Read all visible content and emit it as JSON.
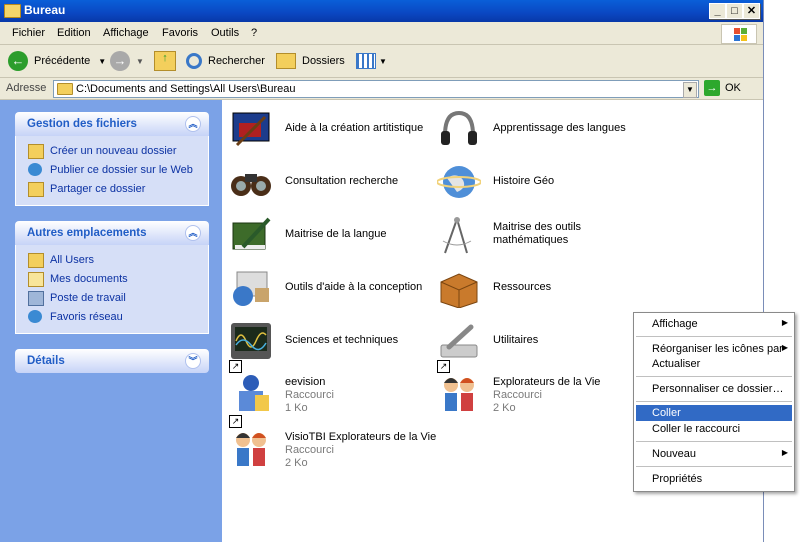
{
  "window": {
    "title": "Bureau",
    "minimize_glyph": "_",
    "maximize_glyph": "□",
    "close_glyph": "✕"
  },
  "menu": [
    "Fichier",
    "Edition",
    "Affichage",
    "Favoris",
    "Outils",
    "?"
  ],
  "toolbar": {
    "back": "Précédente",
    "search": "Rechercher",
    "folders": "Dossiers"
  },
  "address": {
    "label": "Adresse",
    "value": "C:\\Documents and Settings\\All Users\\Bureau",
    "go": "OK"
  },
  "sidebar": {
    "file_tasks": {
      "title": "Gestion des fichiers",
      "items": [
        "Créer un nouveau dossier",
        "Publier ce dossier sur le Web",
        "Partager ce dossier"
      ]
    },
    "other_places": {
      "title": "Autres emplacements",
      "items": [
        "All Users",
        "Mes documents",
        "Poste de travail",
        "Favoris réseau"
      ]
    },
    "details": {
      "title": "Détails"
    }
  },
  "items": [
    {
      "name": "Aide à la création artitistique",
      "icon": "art-palette-icon"
    },
    {
      "name": "Apprentissage des langues",
      "icon": "headphones-icon"
    },
    {
      "name": "Consultation recherche",
      "icon": "binoculars-icon"
    },
    {
      "name": "Histoire Géo",
      "icon": "globe-icon"
    },
    {
      "name": "Maitrise de la langue",
      "icon": "book-pen-icon"
    },
    {
      "name": "Maitrise des outils mathématiques",
      "icon": "compass-icon"
    },
    {
      "name": "Outils d'aide à la conception",
      "icon": "tools-globe-icon"
    },
    {
      "name": "Ressources",
      "icon": "box-icon"
    },
    {
      "name": "Sciences et techniques",
      "icon": "oscilloscope-icon"
    },
    {
      "name": "Utilitaires",
      "icon": "wrench-icon"
    },
    {
      "name": "eevision",
      "sub": "Raccourci",
      "size": "1 Ko",
      "icon": "eevision-shortcut-icon"
    },
    {
      "name": "Explorateurs de la Vie",
      "sub": "Raccourci",
      "size": "2 Ko",
      "icon": "explorateurs-shortcut-icon"
    },
    {
      "name": "VisioTBI Explorateurs de la Vie",
      "sub": "Raccourci",
      "size": "2 Ko",
      "icon": "visiotbi-shortcut-icon"
    }
  ],
  "context_menu": {
    "items": [
      {
        "label": "Affichage",
        "submenu": true
      },
      {
        "label": "Réorganiser les icônes par",
        "submenu": true
      },
      {
        "label": "Actualiser"
      },
      {
        "label": "Personnaliser ce dossier…"
      },
      {
        "label": "Coller",
        "selected": true
      },
      {
        "label": "Coller le raccourci"
      },
      {
        "label": "Nouveau",
        "submenu": true
      },
      {
        "label": "Propriétés"
      }
    ]
  },
  "colors": {
    "titlebar": "#0a5fd8",
    "sidebar": "#7ba2e7",
    "selection": "#316ac5",
    "link": "#0c32a3"
  }
}
